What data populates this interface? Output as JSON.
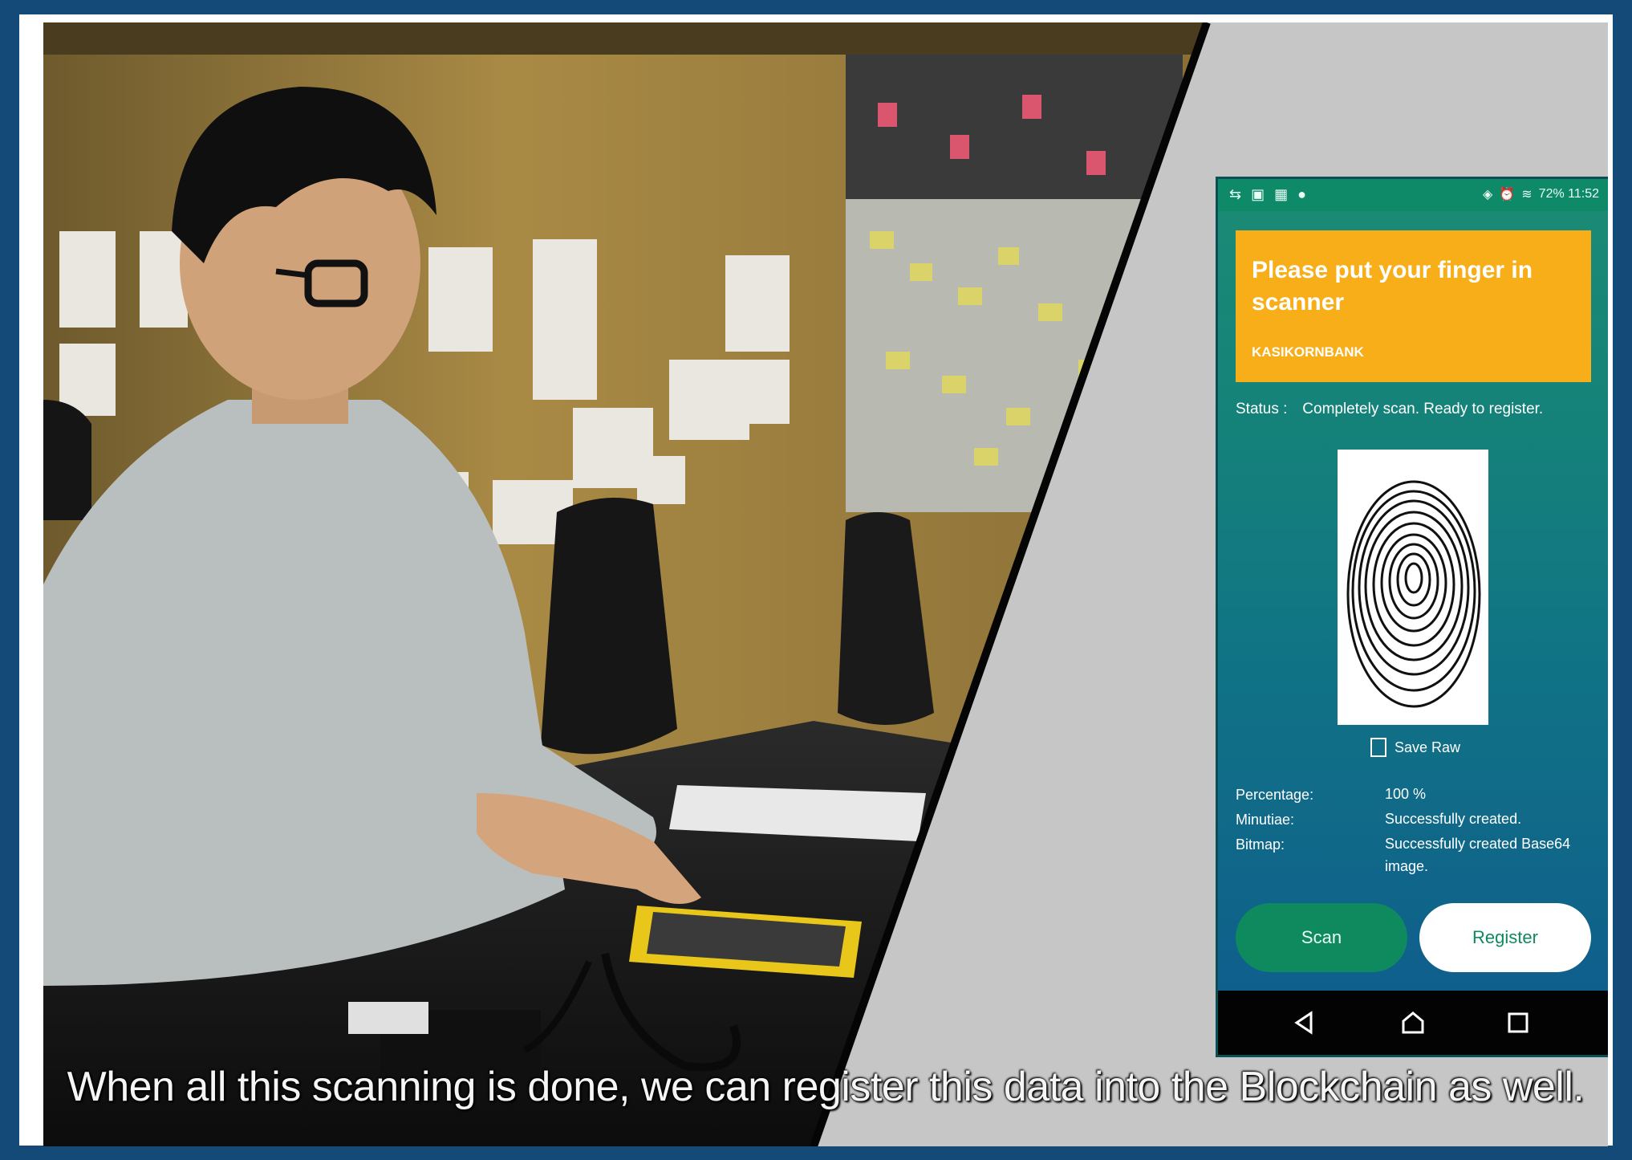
{
  "phone": {
    "header": {
      "title": "Please put your finger in scanner",
      "subtitle": "KASIKORNBANK"
    },
    "status": {
      "label": "Status :",
      "value": "Completely scan. Ready to register."
    },
    "save_raw_label": "Save Raw",
    "save_raw_checked": false,
    "info": [
      {
        "key": "Percentage:",
        "value": "100 %"
      },
      {
        "key": "Minutiae:",
        "value": "Successfully created."
      },
      {
        "key": "Bitmap:",
        "value": "Successfully created Base64 image."
      }
    ],
    "buttons": {
      "scan": "Scan",
      "register": "Register"
    },
    "statusbar_right": "72%  11:52"
  },
  "subtitle": "When all this scanning is done, we can register this data into the Blockchain as well."
}
